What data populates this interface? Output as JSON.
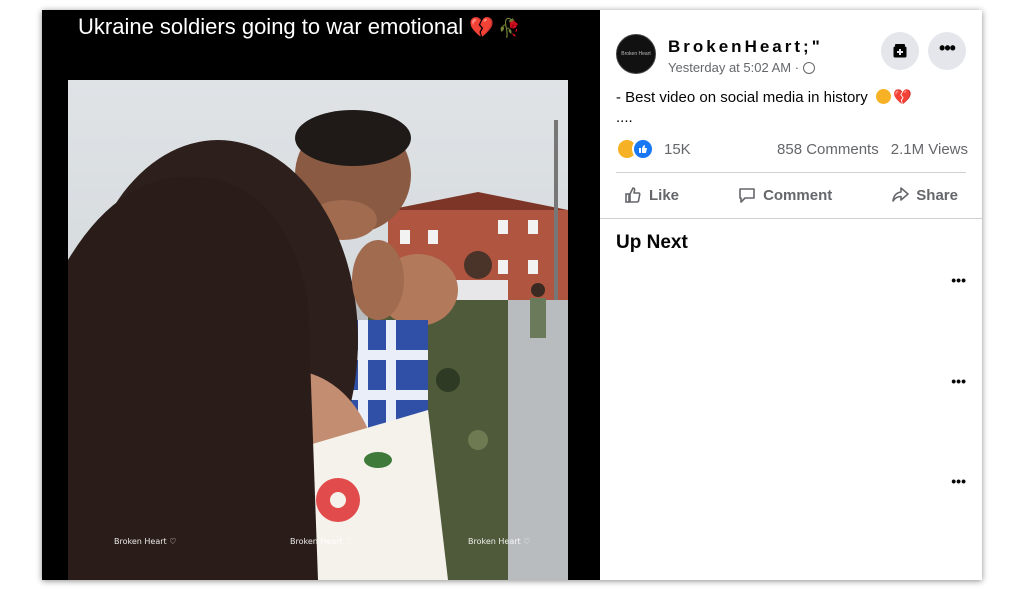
{
  "video": {
    "overlay_title": "Ukraine soldiers going to war emotional",
    "overlay_emojis": [
      "💔",
      "🥀"
    ],
    "watermarks": [
      "Broken Heart ♡",
      "Broken Heart ♡",
      "Broken Heart ♡"
    ]
  },
  "post": {
    "page_name": "BrokenHeart;\"",
    "avatar_text": "Broken Heart",
    "timestamp": "Yesterday at 5:02 AM · ",
    "caption_line1": "- Best video on social media in history ",
    "caption_emoji": "💔",
    "caption_line2": "....",
    "reaction_count": "15K",
    "comments": "858 Comments",
    "views": "2.1M Views"
  },
  "actions": {
    "like": "Like",
    "comment": "Comment",
    "share": "Share"
  },
  "up_next": {
    "heading": "Up Next",
    "more_label": "•••"
  },
  "icons": {
    "save": "save-icon",
    "more": "more-icon",
    "globe": "globe-icon",
    "like": "thumbs-up-icon",
    "comment": "comment-icon",
    "share": "share-icon"
  },
  "colors": {
    "facebook_blue": "#1877f2",
    "muted_text": "#65676b",
    "button_bg": "#e4e6eb"
  }
}
